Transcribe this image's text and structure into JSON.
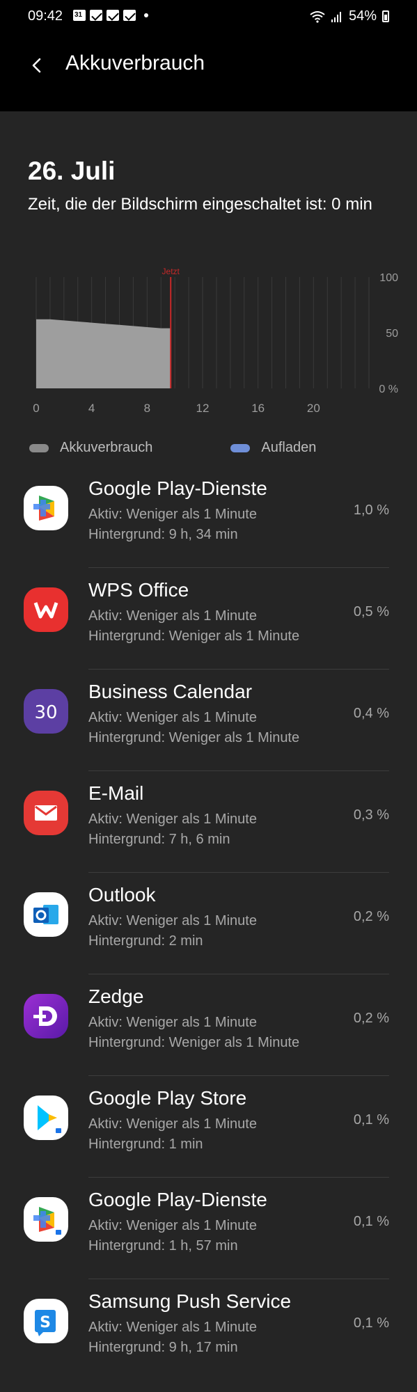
{
  "status_bar": {
    "time": "09:42",
    "battery": "54%"
  },
  "app_bar": {
    "title": "Akkuverbrauch"
  },
  "summary": {
    "date": "26. Juli",
    "screen_time": "Zeit, die der Bildschirm eingeschaltet ist: 0 min"
  },
  "chart_data": {
    "type": "area",
    "marker_label": "Jetzt",
    "x_ticks": [
      "0",
      "4",
      "8",
      "12",
      "16",
      "20"
    ],
    "y_ticks": [
      "100",
      "50",
      "0 %"
    ],
    "xlim": [
      0,
      24
    ],
    "ylim": [
      0,
      100
    ],
    "series": [
      {
        "name": "Akkuverbrauch",
        "x": [
          0,
          1,
          2,
          3,
          4,
          5,
          6,
          7,
          8,
          9,
          9.7
        ],
        "y": [
          62,
          62,
          61,
          60,
          59,
          58,
          57,
          56,
          55,
          54,
          54
        ]
      }
    ],
    "now_x": 9.7,
    "grid": true,
    "colors": {
      "area": "#9e9e9e",
      "marker": "#c62828",
      "grid": "#3a3a3a"
    }
  },
  "legend": [
    {
      "label": "Akkuverbrauch",
      "color": "#8a8a8a"
    },
    {
      "label": "Aufladen",
      "color": "#6f8fd8"
    }
  ],
  "apps": [
    {
      "name": "Google Play-Dienste",
      "active": "Aktiv: Weniger als 1 Minute",
      "background": "Hintergrund: 9 h, 34 min",
      "percent": "1,0 %",
      "icon": "google-play-services-icon"
    },
    {
      "name": "WPS Office",
      "active": "Aktiv: Weniger als 1 Minute",
      "background": "Hintergrund: Weniger als 1 Minute",
      "percent": "0,5 %",
      "icon": "wps-office-icon"
    },
    {
      "name": "Business Calendar",
      "active": "Aktiv: Weniger als 1 Minute",
      "background": "Hintergrund: Weniger als 1 Minute",
      "percent": "0,4 %",
      "icon": "business-calendar-icon"
    },
    {
      "name": "E-Mail",
      "active": "Aktiv: Weniger als 1 Minute",
      "background": "Hintergrund: 7 h, 6 min",
      "percent": "0,3 %",
      "icon": "email-icon"
    },
    {
      "name": "Outlook",
      "active": "Aktiv: Weniger als 1 Minute",
      "background": "Hintergrund: 2 min",
      "percent": "0,2 %",
      "icon": "outlook-icon"
    },
    {
      "name": "Zedge",
      "active": "Aktiv: Weniger als 1 Minute",
      "background": "Hintergrund: Weniger als 1 Minute",
      "percent": "0,2 %",
      "icon": "zedge-icon"
    },
    {
      "name": "Google Play Store",
      "active": "Aktiv: Weniger als 1 Minute",
      "background": "Hintergrund: 1 min",
      "percent": "0,1 %",
      "icon": "google-play-store-icon"
    },
    {
      "name": "Google Play-Dienste",
      "active": "Aktiv: Weniger als 1 Minute",
      "background": "Hintergrund: 1 h, 57 min",
      "percent": "0,1 %",
      "icon": "google-play-services-icon"
    },
    {
      "name": "Samsung Push Service",
      "active": "Aktiv: Weniger als 1 Minute",
      "background": "Hintergrund: 9 h, 17 min",
      "percent": "0,1 %",
      "icon": "samsung-push-service-icon"
    }
  ]
}
